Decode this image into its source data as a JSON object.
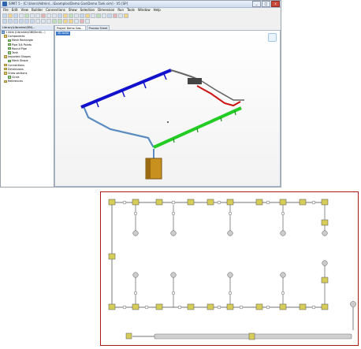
{
  "window": {
    "title": "SIMIT 5 - [C:\\Users\\Admin\\...\\Examples\\Demo Gas\\Demo Tank.sim] - V5 [SP]",
    "controls": [
      "_",
      "□",
      "x"
    ]
  },
  "menubar": {
    "items": [
      "File",
      "Edit",
      "View",
      "Builder",
      "Connections",
      "Show",
      "Selection",
      "Dimension",
      "Run",
      "Tools",
      "Window",
      "Help"
    ]
  },
  "tree": {
    "tab": "Library\\Libraries\\GBI\\...",
    "nodes": [
      "1 item (Libraries\\GBI\\Simit\\...)",
      "Components",
      "Mesh Rectangle",
      "Pipe 3/4 Points",
      "Round Pipe",
      "Tank",
      "Imported Shapes",
      "Mesh Shape",
      "Connections",
      "Dimensions",
      "Cross sections",
      "Circle",
      "References"
    ]
  },
  "view": {
    "tabs": [
      "Project Demo Gas...",
      "Process Sheet"
    ],
    "label": "3D build"
  },
  "colors": {
    "pipe_blue": "#1111cc",
    "pipe_green": "#22cc22",
    "pipe_red": "#cc1111",
    "pipe_gray": "#555555",
    "pipe_steel": "#5a8cc0",
    "tank": "#c8901e",
    "diagram_border": "#b01818",
    "node_box": "#d6cc5a"
  }
}
